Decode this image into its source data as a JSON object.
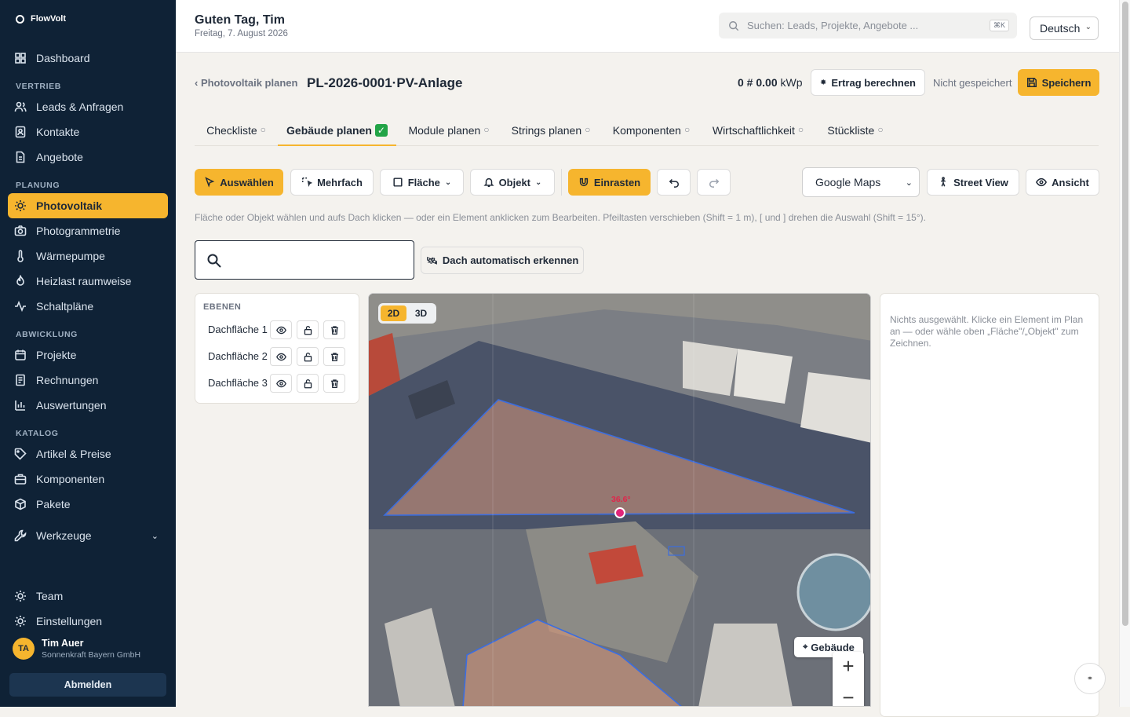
{
  "app": {
    "name": "FlowVolt"
  },
  "sidebar": {
    "top_items": [
      {
        "label": "Dashboard"
      }
    ],
    "sections": [
      {
        "title": "VERTRIEB",
        "items": [
          {
            "label": "Leads & Anfragen"
          },
          {
            "label": "Kontakte"
          },
          {
            "label": "Angebote"
          }
        ]
      },
      {
        "title": "PLANUNG",
        "items": [
          {
            "label": "Photovoltaik"
          },
          {
            "label": "Photogrammetrie"
          },
          {
            "label": "Wärmepumpe"
          },
          {
            "label": "Heizlast raumweise"
          },
          {
            "label": "Schaltpläne"
          }
        ]
      },
      {
        "title": "ABWICKLUNG",
        "items": [
          {
            "label": "Projekte"
          },
          {
            "label": "Rechnungen"
          },
          {
            "label": "Auswertungen"
          }
        ]
      },
      {
        "title": "KATALOG",
        "items": [
          {
            "label": "Artikel & Preise"
          },
          {
            "label": "Komponenten"
          },
          {
            "label": "Pakete"
          }
        ]
      }
    ],
    "tools_label": "Werkzeuge",
    "bottom_items": [
      {
        "label": "Team"
      },
      {
        "label": "Einstellungen"
      }
    ],
    "active_item": "Photovoltaik",
    "user": {
      "initials": "TA",
      "name": "Tim Auer",
      "company": "Sonnenkraft Bayern GmbH"
    },
    "logout_label": "Abmelden"
  },
  "header": {
    "greeting": "Guten Tag, Tim",
    "date": "Freitag, 7. August 2026",
    "search_placeholder": "Suchen: Leads, Projekte, Angebote ...",
    "search_shortcut": "⌘K",
    "language": "Deutsch"
  },
  "page": {
    "breadcrumb": "‹ Photovoltaik planen",
    "title": "PL-2026-0001·PV-Anlage",
    "kwp_value": "0 # 0.00",
    "kwp_unit": "kWp",
    "calc_button": "Ertrag berechnen",
    "save_status": "Nicht gespeichert",
    "save_button": "Speichern"
  },
  "tabs": [
    {
      "label": "Checkliste",
      "done": false
    },
    {
      "label": "Gebäude planen",
      "done": true
    },
    {
      "label": "Module planen",
      "done": false
    },
    {
      "label": "Strings planen",
      "done": false
    },
    {
      "label": "Komponenten",
      "done": false
    },
    {
      "label": "Wirtschaftlichkeit",
      "done": false
    },
    {
      "label": "Stückliste",
      "done": false
    }
  ],
  "toolbar": {
    "select": "Auswählen",
    "multi": "Mehrfach",
    "area": "Fläche",
    "object": "Objekt",
    "snap": "Einrasten",
    "map_source": "Google Maps",
    "street_view": "Street View",
    "view": "Ansicht"
  },
  "hint": "Fläche oder Objekt wählen und aufs Dach klicken — oder ein Element anklicken zum Bearbeiten. Pfeiltasten verschieben (Shift = 1 m), [ und ] drehen die Auswahl (Shift = 15°).",
  "address": {
    "value": ""
  },
  "auto_detect": "Dach automatisch erkennen",
  "layers": {
    "title": "EBENEN",
    "items": [
      {
        "name": "Dachfläche 1"
      },
      {
        "name": "Dachfläche 2"
      },
      {
        "name": "Dachfläche 3"
      }
    ]
  },
  "map": {
    "view_2d": "2D",
    "view_3d": "3D",
    "angle_label": "36.6°",
    "building_button": "Gebäude",
    "zoom_in": "+",
    "zoom_out": "−"
  },
  "props_panel": {
    "empty_text": "Nichts ausgewählt. Klicke ein Element im Plan an — oder wähle oben „Fläche\"/„Objekt\" zum Zeichnen."
  },
  "fab_label": "⚭",
  "colors": {
    "sidebar": "#0f2236",
    "accent": "#f6b52e",
    "roof_outline": "#3b6de0",
    "angle": "#e0264b"
  }
}
